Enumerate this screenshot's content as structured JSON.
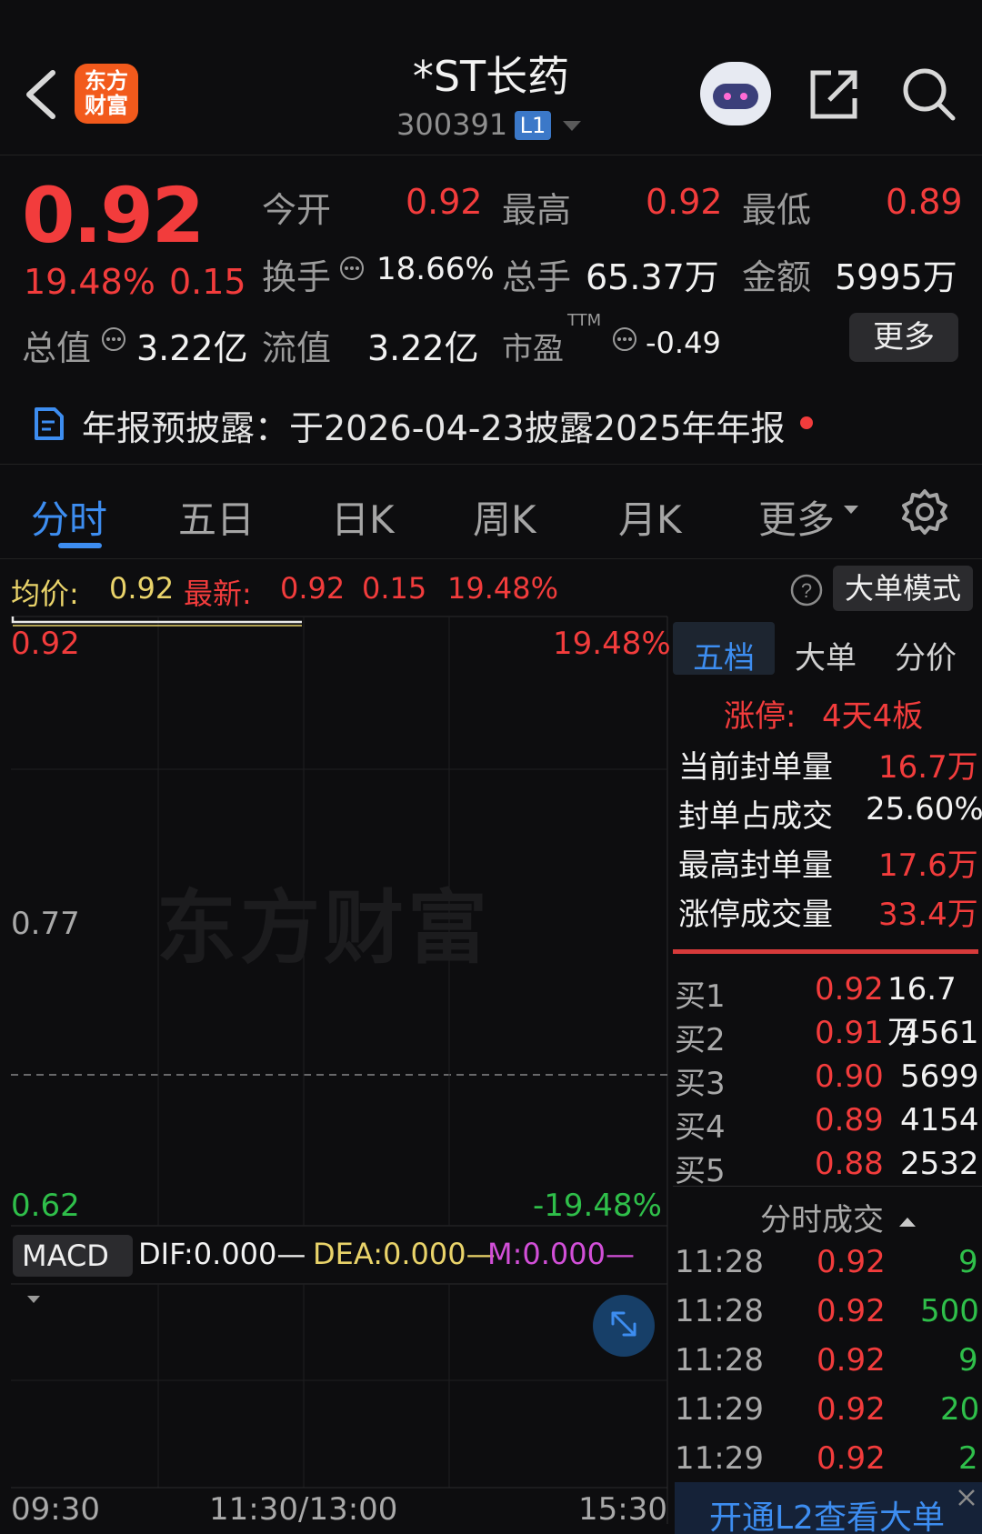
{
  "header": {
    "logo_text_1": "东方",
    "logo_text_2": "财富",
    "title": "*ST长药",
    "code": "300391",
    "level_badge": "L1",
    "icons": [
      "back-icon",
      "robot-avatar-icon",
      "share-icon",
      "search-icon"
    ]
  },
  "quote": {
    "price": "0.92",
    "change_pct": "19.48%",
    "change_abs": "0.15",
    "fields": [
      {
        "label": "今开",
        "value": "0.92"
      },
      {
        "label": "最高",
        "value": "0.92"
      },
      {
        "label": "最低",
        "value": "0.89"
      },
      {
        "label": "换手",
        "value": "18.66%"
      },
      {
        "label": "总手",
        "value": "65.37万"
      },
      {
        "label": "金额",
        "value": "5995万"
      },
      {
        "label": "总值",
        "value": "3.22亿"
      },
      {
        "label": "流值",
        "value": "3.22亿"
      },
      {
        "label": "市盈",
        "sup": "TTM",
        "value": "-0.49"
      }
    ],
    "more_label": "更多"
  },
  "notice": {
    "text": "年报预披露：于2026-04-23披露2025年年报"
  },
  "tabs": [
    "分时",
    "五日",
    "日K",
    "周K",
    "月K",
    "更多"
  ],
  "active_tab": "分时",
  "info_bar": {
    "avg_label": "均价:",
    "avg_value": "0.92",
    "latest_label": "最新:",
    "latest_price": "0.92",
    "latest_change": "0.15",
    "latest_pct": "19.48%",
    "mode_button": "大单模式"
  },
  "chart": {
    "price_top": "0.92",
    "pct_top": "19.48%",
    "price_mid": "0.77",
    "price_bottom": "0.62",
    "pct_bottom": "-19.48%",
    "watermark": "东方财富",
    "time_start": "09:30",
    "time_mid": "11:30/13:00",
    "time_end": "15:30"
  },
  "macd": {
    "selector": "MACD",
    "dif": "DIF:0.000",
    "dea": "DEA:0.000",
    "m": "M:0.000"
  },
  "right_panel": {
    "tabs": [
      "五档",
      "大单",
      "分价"
    ],
    "limit_label": "涨停:",
    "limit_value": "4天4板",
    "stats": [
      {
        "label": "当前封单量",
        "value": "16.7万",
        "color": "#f23c3c"
      },
      {
        "label": "封单占成交",
        "value": "25.60%",
        "color": "#f2f2f2"
      },
      {
        "label": "最高封单量",
        "value": "17.6万",
        "color": "#f23c3c"
      },
      {
        "label": "涨停成交量",
        "value": "33.4万",
        "color": "#f23c3c"
      }
    ],
    "bids": [
      {
        "label": "买1",
        "price": "0.92",
        "vol": "16.7万"
      },
      {
        "label": "买2",
        "price": "0.91",
        "vol": "4561"
      },
      {
        "label": "买3",
        "price": "0.90",
        "vol": "5699"
      },
      {
        "label": "买4",
        "price": "0.89",
        "vol": "4154"
      },
      {
        "label": "买5",
        "price": "0.88",
        "vol": "2532"
      }
    ],
    "ticks_header": "分时成交",
    "ticks": [
      {
        "time": "11:28",
        "price": "0.92",
        "vol": "9"
      },
      {
        "time": "11:28",
        "price": "0.92",
        "vol": "500"
      },
      {
        "time": "11:28",
        "price": "0.92",
        "vol": "9"
      },
      {
        "time": "11:29",
        "price": "0.92",
        "vol": "20"
      },
      {
        "time": "11:29",
        "price": "0.92",
        "vol": "2"
      }
    ],
    "l2_promo": "开通L2查看大单"
  }
}
